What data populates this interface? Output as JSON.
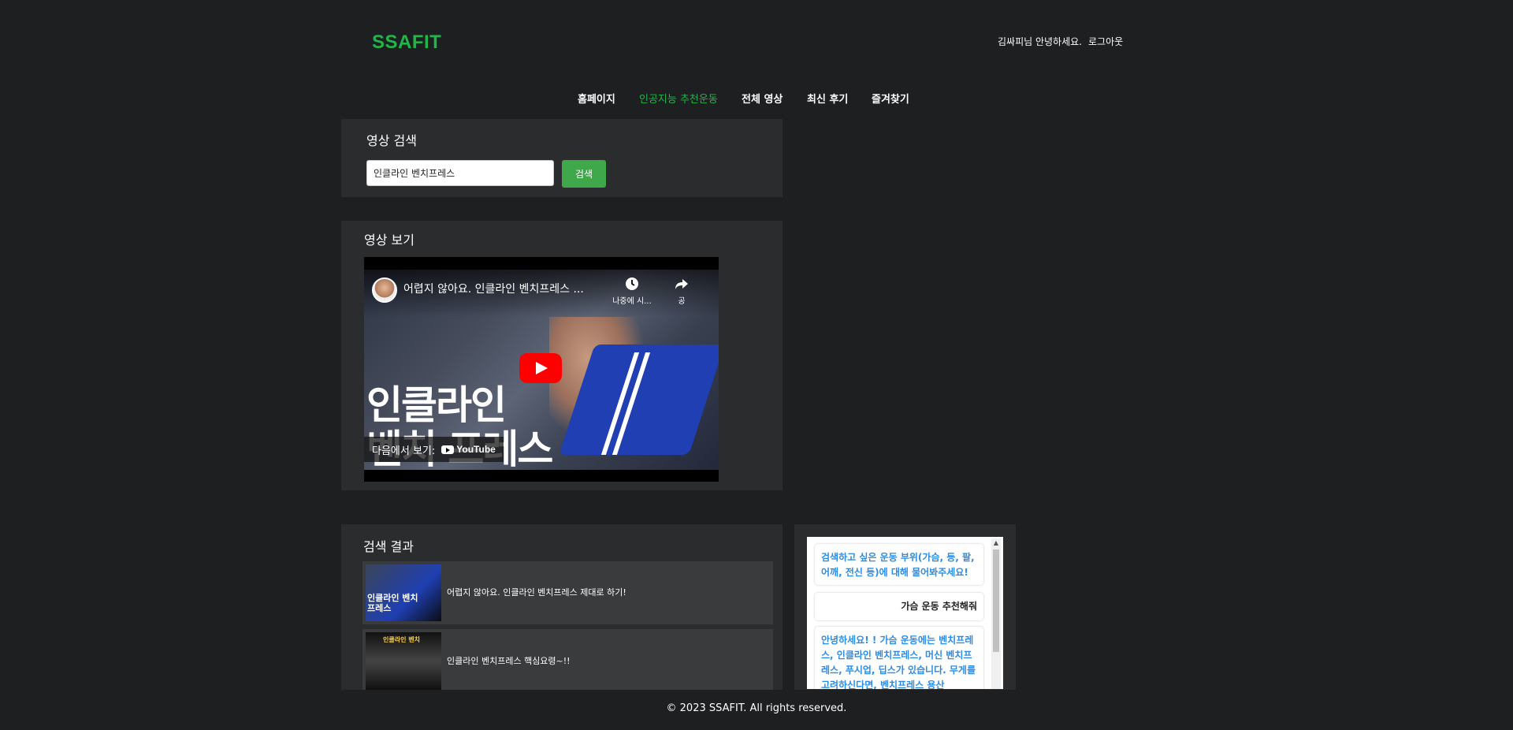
{
  "header": {
    "logo": "SSAFIT",
    "greeting": "김싸피님 안녕하세요.",
    "logout": "로그아웃"
  },
  "nav": {
    "items": [
      {
        "label": "홈페이지",
        "active": false
      },
      {
        "label": "인공지능 추천운동",
        "active": true
      },
      {
        "label": "전체 영상",
        "active": false
      },
      {
        "label": "최신 후기",
        "active": false
      },
      {
        "label": "즐겨찾기",
        "active": false
      }
    ]
  },
  "search": {
    "title": "영상 검색",
    "input_value": "인클라인 벤치프레스",
    "button_label": "검색"
  },
  "viewer": {
    "title": "영상 보기",
    "video_title": "어렵지 않아요. 인클라인 벤치프레스 ...",
    "watch_later": "나중에 시...",
    "share": "공",
    "thumbnail_text_line1": "인클라인",
    "thumbnail_text_line2": "벤치 프레스",
    "watch_on": "다음에서 보기:",
    "youtube": "YouTube"
  },
  "results": {
    "title": "검색 결과",
    "items": [
      {
        "title": "어렵지 않아요. 인클라인 벤치프레스 제대로 하기!",
        "thumb_text": "인클라인 벤치 프레스"
      },
      {
        "title": "인클라인 벤치프레스 핵심요령~!!",
        "thumb_text": "인클라인 벤치"
      }
    ]
  },
  "chat": {
    "messages": [
      {
        "role": "bot",
        "text": "검색하고 싶은 운동 부위(가슴, 등, 팔, 어깨, 전신 등)에 대해 물어봐주세요!"
      },
      {
        "role": "user",
        "text": "가슴 운동 추천해줘"
      },
      {
        "role": "bot",
        "text": "안녕하세요! ! 가슴 운동에는 벤치프레스, 인클라인 벤치프레스, 머신 벤치프레스, 푸시업, 딥스가 있습니다. 무게를 고려하신다면, 벤치프레스 용산"
      }
    ]
  },
  "footer": {
    "text": "© 2023 SSAFIT. All rights reserved."
  },
  "colors": {
    "background": "#1e1f21",
    "panel": "#2b2c2e",
    "accent": "#21b64a",
    "button": "#3fa84a",
    "chat_bot": "#2b8ce6"
  }
}
